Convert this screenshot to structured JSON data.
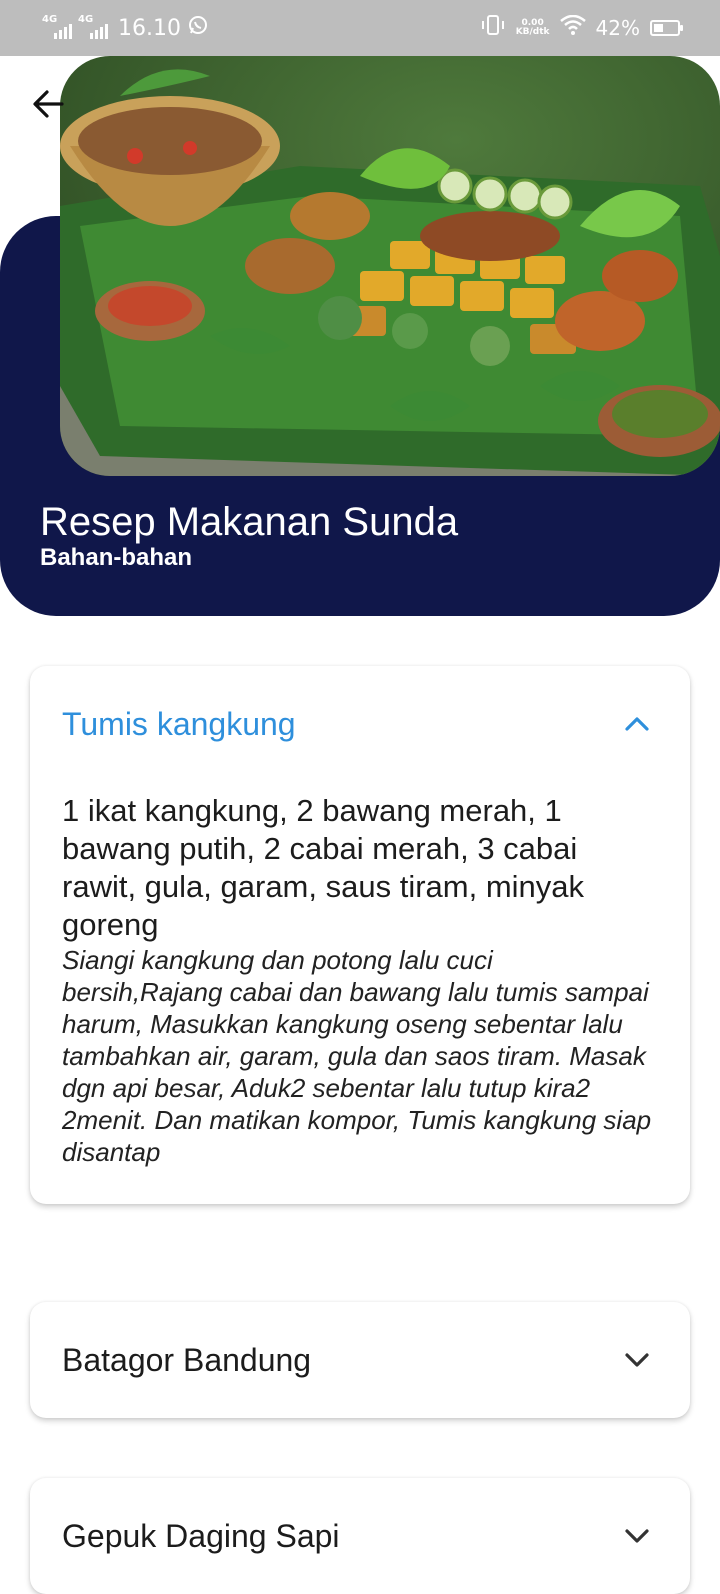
{
  "status_bar": {
    "network_label": "4G",
    "time": "16.10",
    "speed_value": "0.00",
    "speed_unit": "KB/dtk",
    "battery_percent": "42%",
    "battery_level": 0.42
  },
  "header": {
    "title": "Resep Makanan Sunda",
    "subtitle": "Bahan-bahan",
    "accent_color": "#10174a"
  },
  "recipes": [
    {
      "name": "Tumis kangkung",
      "expanded": true,
      "ingredients": "1 ikat kangkung, 2 bawang merah, 1 bawang putih, 2 cabai merah, 3 cabai rawit, gula, garam, saus tiram, minyak goreng",
      "steps": "Siangi kangkung dan potong lalu cuci bersih,Rajang cabai dan bawang lalu tumis sampai harum, Masukkan kangkung oseng sebentar lalu tambahkan air, garam, gula dan saos tiram. Masak dgn api besar, Aduk2 sebentar lalu tutup kira2 2menit. Dan matikan kompor, Tumis kangkung siap disantap"
    },
    {
      "name": "Batagor Bandung",
      "expanded": false
    },
    {
      "name": "Gepuk Daging Sapi",
      "expanded": false
    }
  ],
  "colors": {
    "expanded_title": "#2e8fdc",
    "collapsed_title": "#1c1c1c",
    "status_bar": "#bdbdbd"
  }
}
